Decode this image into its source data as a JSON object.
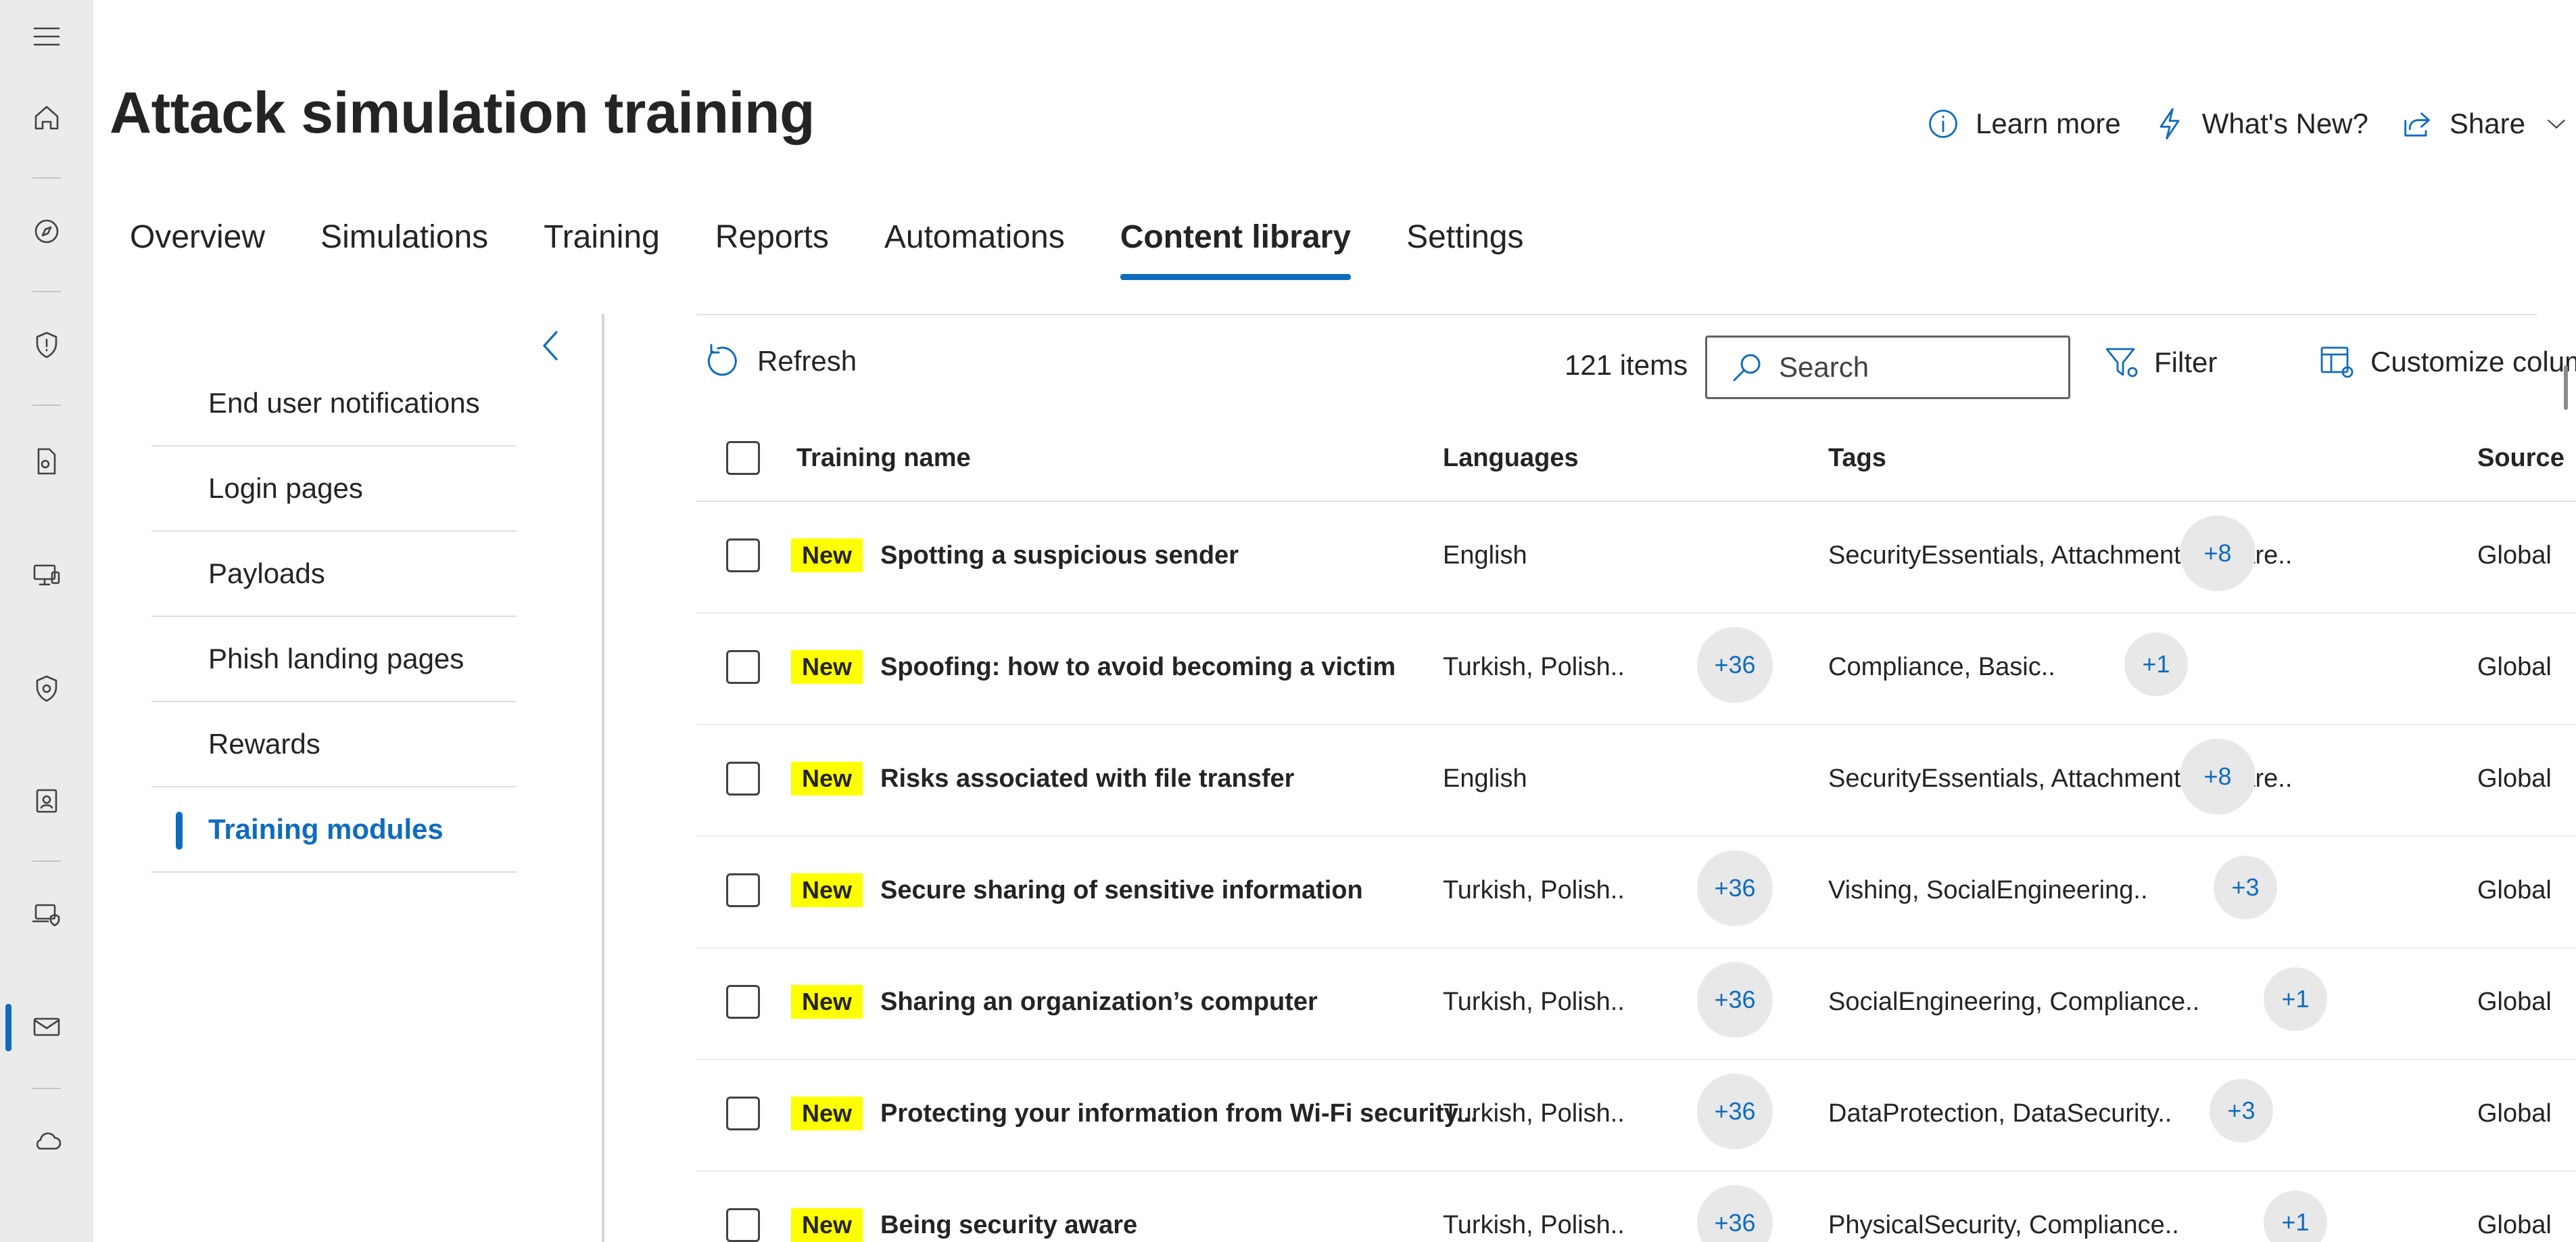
{
  "header": {
    "title": "Attack simulation training",
    "actions": {
      "learn_more": "Learn more",
      "whats_new": "What's New?",
      "share": "Share"
    }
  },
  "tabs": [
    {
      "label": "Overview",
      "active": false
    },
    {
      "label": "Simulations",
      "active": false
    },
    {
      "label": "Training",
      "active": false
    },
    {
      "label": "Reports",
      "active": false
    },
    {
      "label": "Automations",
      "active": false
    },
    {
      "label": "Content library",
      "active": true
    },
    {
      "label": "Settings",
      "active": false
    }
  ],
  "subnav": {
    "items": [
      {
        "label": "End user notifications",
        "active": false
      },
      {
        "label": "Login pages",
        "active": false
      },
      {
        "label": "Payloads",
        "active": false
      },
      {
        "label": "Phish landing pages",
        "active": false
      },
      {
        "label": "Rewards",
        "active": false
      },
      {
        "label": "Training modules",
        "active": true
      }
    ]
  },
  "commandbar": {
    "refresh": "Refresh",
    "items_count": "121 items",
    "search_placeholder": "Search",
    "filter": "Filter",
    "customize_columns": "Customize columns"
  },
  "table": {
    "columns": {
      "name": "Training name",
      "languages": "Languages",
      "tags": "Tags",
      "source": "Source"
    },
    "rows": [
      {
        "badge": "New",
        "name": "Spotting a suspicious sender",
        "languages": "English",
        "languages_more": "",
        "tags": "SecurityEssentials, AttachmentMalware..",
        "tags_more": "+8",
        "source": "Global"
      },
      {
        "badge": "New",
        "name": "Spoofing: how to avoid becoming a victim",
        "languages": "Turkish, Polish..",
        "languages_more": "+36",
        "tags": "Compliance, Basic..",
        "tags_more": "+1",
        "source": "Global"
      },
      {
        "badge": "New",
        "name": "Risks associated with file transfer",
        "languages": "English",
        "languages_more": "",
        "tags": "SecurityEssentials, AttachmentMalware..",
        "tags_more": "+8",
        "source": "Global"
      },
      {
        "badge": "New",
        "name": "Secure sharing of sensitive information",
        "languages": "Turkish, Polish..",
        "languages_more": "+36",
        "tags": "Vishing, SocialEngineering..",
        "tags_more": "+3",
        "source": "Global"
      },
      {
        "badge": "New",
        "name": "Sharing an organization’s computer",
        "languages": "Turkish, Polish..",
        "languages_more": "+36",
        "tags": "SocialEngineering, Compliance..",
        "tags_more": "+1",
        "source": "Global"
      },
      {
        "badge": "New",
        "name": "Protecting your information from Wi-Fi security...",
        "languages": "Turkish, Polish..",
        "languages_more": "+36",
        "tags": "DataProtection, DataSecurity..",
        "tags_more": "+3",
        "source": "Global"
      },
      {
        "badge": "New",
        "name": "Being security aware",
        "languages": "Turkish, Polish..",
        "languages_more": "+36",
        "tags": "PhysicalSecurity, Compliance..",
        "tags_more": "+1",
        "source": "Global"
      }
    ]
  },
  "icons": {
    "rail": [
      "hamburger-icon",
      "home-icon",
      "compass-icon",
      "shield-icon",
      "document-gear-icon",
      "devices-icon",
      "shield-settings-icon",
      "contact-card-icon",
      "laptop-shield-icon",
      "mail-icon",
      "cloud-icon"
    ]
  },
  "colors": {
    "accent": "#0f6cbd",
    "badge": "#ffff00",
    "rail_bg": "#ebebeb"
  }
}
